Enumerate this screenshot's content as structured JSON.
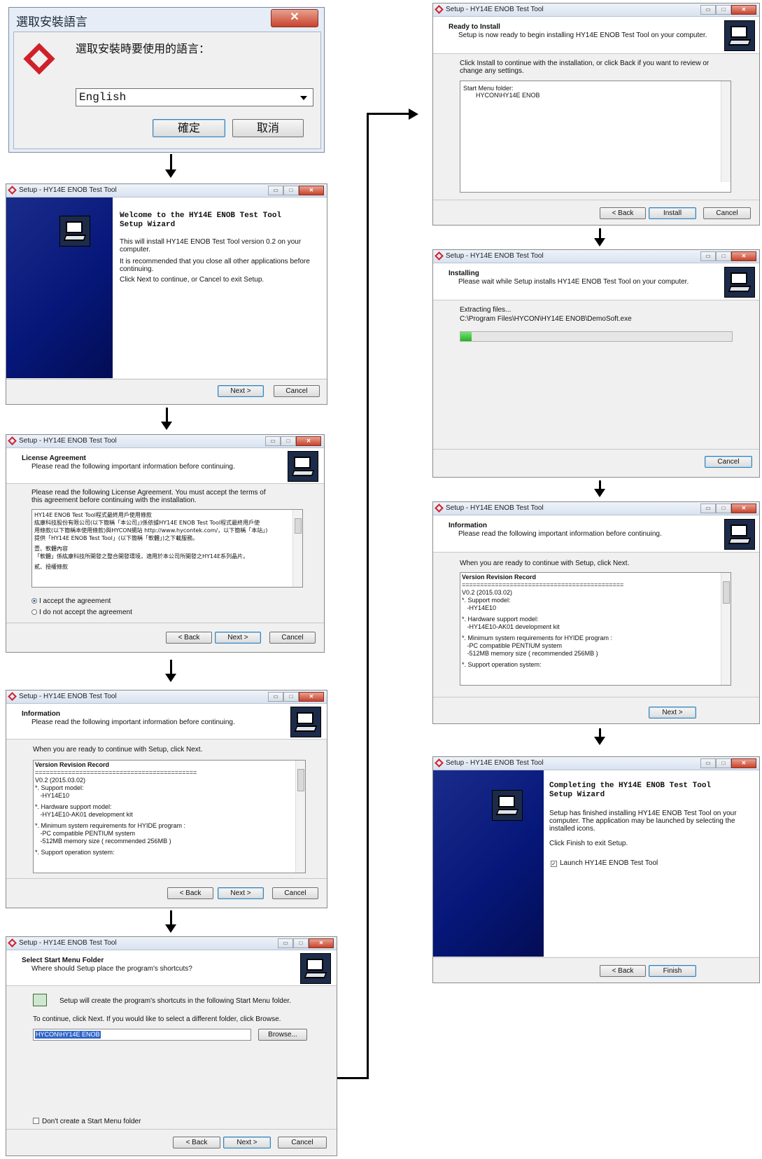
{
  "lang_dialog": {
    "title": "選取安裝語言",
    "prompt": "選取安裝時要使用的語言：",
    "language_value": "English",
    "ok_label": "確定",
    "cancel_label": "取消"
  },
  "window_title": "Setup - HY14E ENOB Test Tool",
  "buttons": {
    "back": "< Back",
    "next": "Next >",
    "cancel": "Cancel",
    "install": "Install",
    "finish": "Finish",
    "browse": "Browse..."
  },
  "welcome": {
    "heading": "Welcome to the HY14E ENOB Test Tool Setup Wizard",
    "p1": "This will install HY14E ENOB Test Tool version 0.2 on your computer.",
    "p2": "It is recommended that you close all other applications before continuing.",
    "p3": "Click Next to continue, or Cancel to exit Setup."
  },
  "license": {
    "h1": "License Agreement",
    "h2": "Please read the following important information before continuing.",
    "intro": "Please read the following License Agreement. You must accept the terms of this agreement before continuing with the installation.",
    "text_lines": [
      "HY14E ENOB Test Tool程式最終用戶使用條款",
      "紘康科技股份有限公司(以下簡稱「本公司」)係依據HY14E ENOB Test Tool程式最終用戶使",
      "用條款(以下簡稱本使用條款)與HYCON網站 http://www.hycontek.com/，以下簡稱「本站」)",
      "提供「HY14E ENOB Test Tool」(以下簡稱「軟體」)之下載服務。",
      "壹、軟體內容",
      "「軟體」係紘康科技所開發之整合開發環境，適用於本公司所開發之HY14E系列晶片。",
      "貳、授權條款"
    ],
    "accept": "I accept the agreement",
    "decline": "I do not accept the agreement"
  },
  "information": {
    "h1": "Information",
    "h2": "Please read the following important information before continuing.",
    "intro": "When you are ready to continue with Setup, click Next.",
    "record_lines": [
      "Version Revision Record",
      "============================================",
      "V0.2 (2015.03.02)",
      "*. Support model:",
      "   -HY14E10",
      "*. Hardware support model:",
      "   -HY14E10-AK01 development kit",
      "*. Minimum system requirements for HYIDE program :",
      "   -PC compatible PENTIUM system",
      "   -512MB memory size ( recommended 256MB )",
      "*. Support operation system:"
    ]
  },
  "start_menu": {
    "h1": "Select Start Menu Folder",
    "h2": "Where should Setup place the program's shortcuts?",
    "line1": "Setup will create the program's shortcuts in the following Start Menu folder.",
    "line2": "To continue, click Next. If you would like to select a different folder, click Browse.",
    "folder_value": "HYCON\\HY14E ENOB",
    "no_folder": "Don't create a Start Menu folder"
  },
  "ready": {
    "h1": "Ready to Install",
    "h2": "Setup is now ready to begin installing HY14E ENOB Test Tool on your computer.",
    "intro": "Click Install to continue with the installation, or click Back if you want to review or change any settings.",
    "memo_label": "Start Menu folder:",
    "memo_value": "HYCON\\HY14E ENOB"
  },
  "installing": {
    "h1": "Installing",
    "h2": "Please wait while Setup installs HY14E ENOB Test Tool on your computer.",
    "status1": "Extracting files...",
    "status2": "C:\\Program Files\\HYCON\\HY14E ENOB\\DemoSoft.exe",
    "progress": 0.04
  },
  "finish": {
    "heading": "Completing the HY14E ENOB Test Tool Setup Wizard",
    "p1": "Setup has finished installing HY14E ENOB Test Tool on your computer. The application may be launched by selecting the installed icons.",
    "p2": "Click Finish to exit Setup.",
    "launch": "Launch HY14E ENOB Test Tool"
  }
}
